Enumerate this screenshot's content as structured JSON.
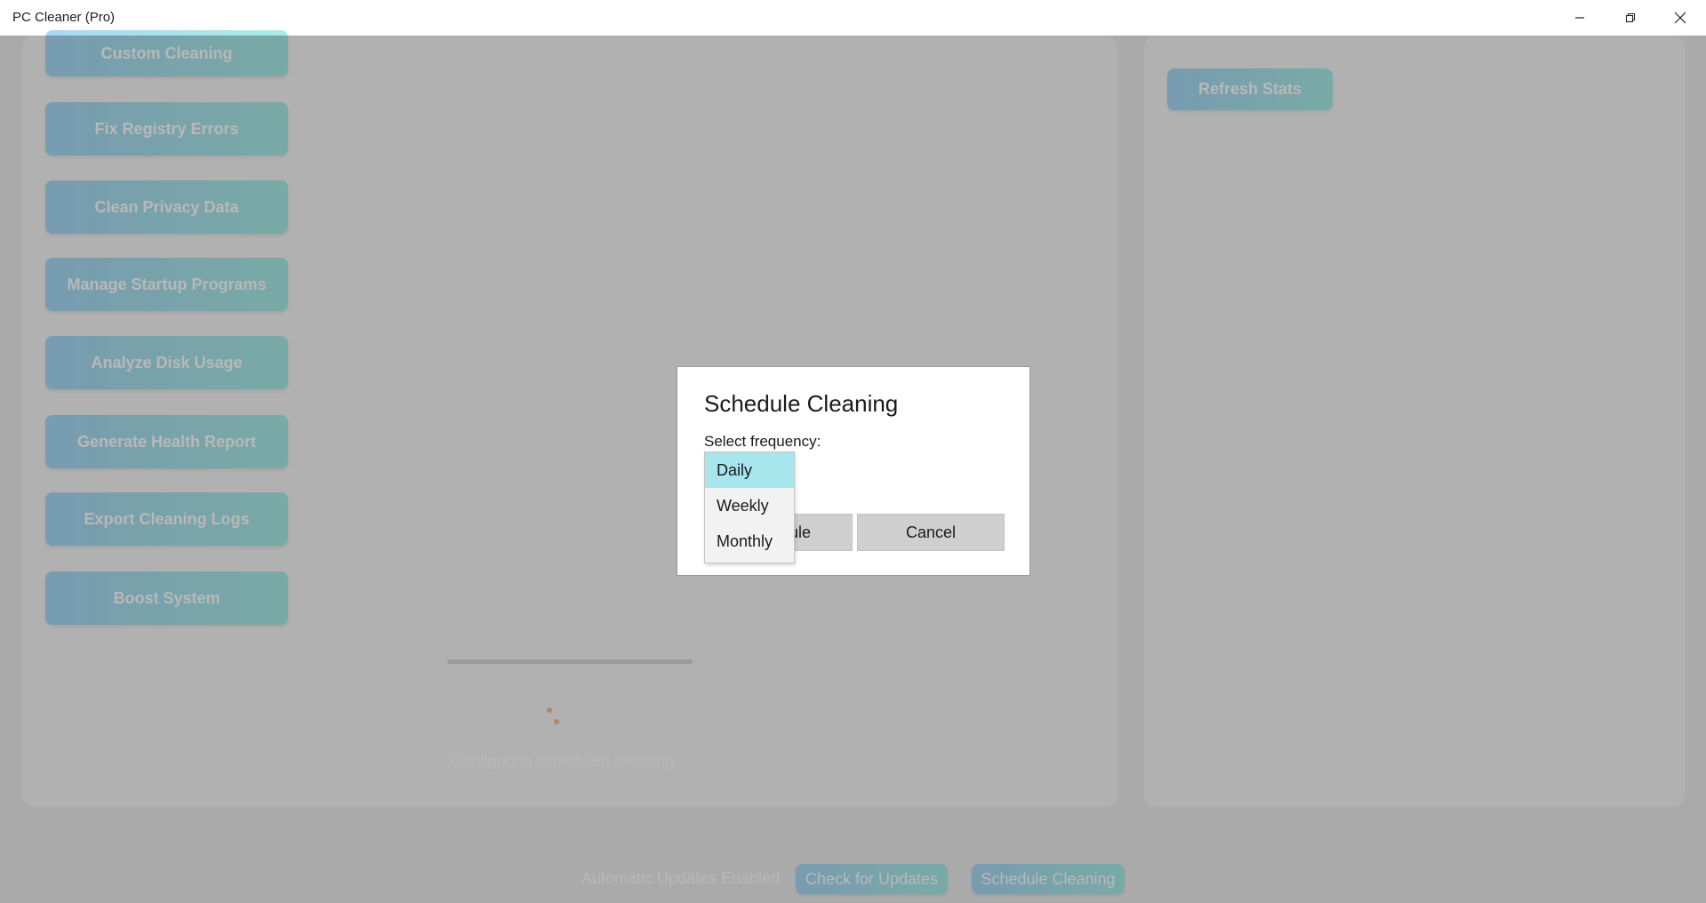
{
  "window": {
    "title": "PC Cleaner (Pro)"
  },
  "sidebar": {
    "buttons": [
      "Custom Cleaning",
      "Fix Registry Errors",
      "Clean Privacy Data",
      "Manage Startup Programs",
      "Analyze Disk Usage",
      "Generate Health Report",
      "Export Cleaning Logs",
      "Boost System"
    ]
  },
  "main": {
    "status_text": "Configuring scheduled cleaning..."
  },
  "right_panel": {
    "refresh_label": "Refresh Stats"
  },
  "footer": {
    "updates_status": "Automatic Updates Enabled",
    "check_updates_label": "Check for Updates",
    "schedule_label": "Schedule Cleaning"
  },
  "dialog": {
    "title": "Schedule Cleaning",
    "label": "Select frequency:",
    "confirm_label_visible": "ule",
    "cancel_label": "Cancel",
    "options": [
      "Daily",
      "Weekly",
      "Monthly"
    ],
    "selected": "Daily"
  },
  "colors": {
    "accent_gradient_start": "#a7d8f5",
    "accent_gradient_end": "#a8ece6",
    "selected_option": "#a6e6ec",
    "spinner": "#f6b98e"
  }
}
